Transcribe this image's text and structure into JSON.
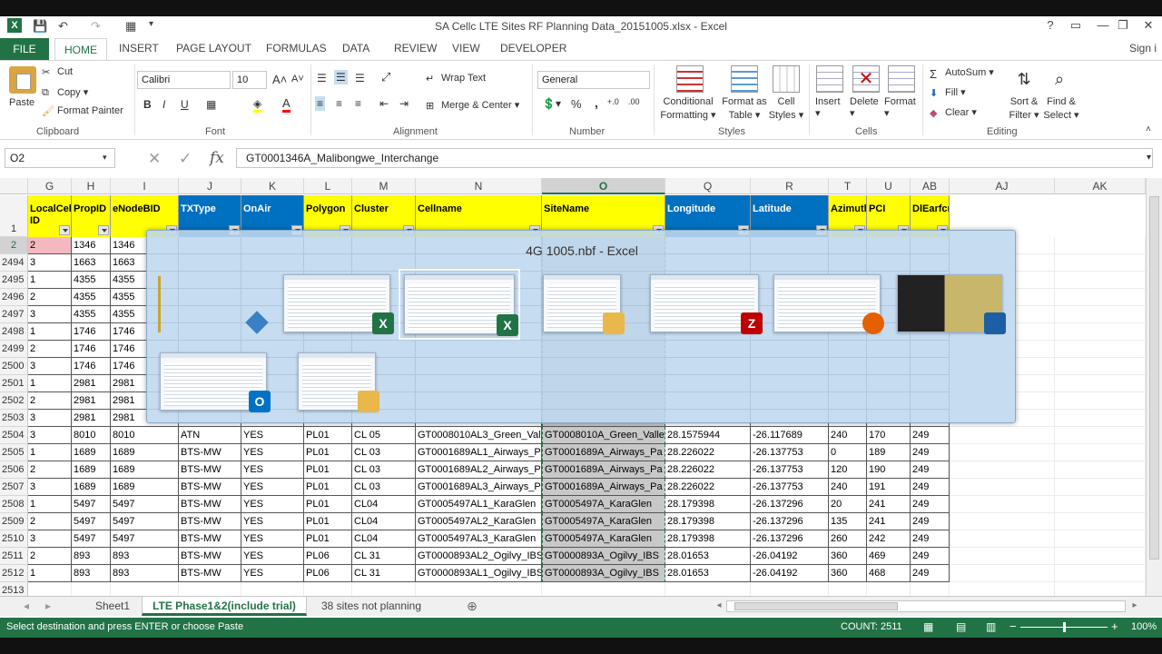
{
  "window": {
    "title": "SA Cellc  LTE  Sites RF Planning Data_20151005.xlsx - Excel",
    "controls": [
      "?",
      "▭",
      "—",
      "❐",
      "✕"
    ],
    "sign_in": "Sign i"
  },
  "ribbon_tabs": [
    "FILE",
    "HOME",
    "INSERT",
    "PAGE LAYOUT",
    "FORMULAS",
    "DATA",
    "REVIEW",
    "VIEW",
    "DEVELOPER"
  ],
  "ribbon": {
    "clipboard": {
      "paste": "Paste",
      "cut": "Cut",
      "copy": "Copy",
      "format_painter": "Format Painter",
      "label": "Clipboard"
    },
    "font": {
      "name": "Calibri",
      "size": "10",
      "bold": "B",
      "italic": "I",
      "underline": "U",
      "label": "Font"
    },
    "alignment": {
      "wrap_text": "Wrap Text",
      "merge_center": "Merge & Center",
      "label": "Alignment"
    },
    "number": {
      "format": "General",
      "percent": "%",
      "comma": ",",
      "label": "Number"
    },
    "styles": {
      "conditional": "Conditional",
      "conditional2": "Formatting",
      "format_as": "Format as",
      "format_as2": "Table",
      "cell": "Cell",
      "cell2": "Styles",
      "label": "Styles"
    },
    "cells": {
      "insert": "Insert",
      "delete": "Delete",
      "format": "Format",
      "label": "Cells"
    },
    "editing": {
      "autosum": "AutoSum",
      "fill": "Fill",
      "clear": "Clear",
      "sort": "Sort &",
      "sort2": "Filter",
      "find": "Find &",
      "find2": "Select",
      "label": "Editing"
    }
  },
  "formula_bar": {
    "name_box": "O2",
    "formula": "GT0001346A_Malibongwe_Interchange",
    "fx": "fx"
  },
  "columns": [
    {
      "letter": "G",
      "header": "LocalCell ID",
      "bg": "#ffff00"
    },
    {
      "letter": "H",
      "header": "PropID",
      "bg": "#ffff00"
    },
    {
      "letter": "I",
      "header": "eNodeBID",
      "bg": "#ffff00"
    },
    {
      "letter": "J",
      "header": "TXType",
      "bg": "#0070c0"
    },
    {
      "letter": "K",
      "header": "OnAir",
      "bg": "#0070c0"
    },
    {
      "letter": "L",
      "header": "Polygon",
      "bg": "#ffff00"
    },
    {
      "letter": "M",
      "header": "Cluster",
      "bg": "#ffff00"
    },
    {
      "letter": "N",
      "header": "Cellname",
      "bg": "#ffff00"
    },
    {
      "letter": "O",
      "header": "SiteName",
      "bg": "#ffff00"
    },
    {
      "letter": "Q",
      "header": "Longitude",
      "bg": "#0070c0"
    },
    {
      "letter": "R",
      "header": "Latitude",
      "bg": "#0070c0"
    },
    {
      "letter": "T",
      "header": "Azimuth",
      "bg": "#ffff00"
    },
    {
      "letter": "U",
      "header": "PCI",
      "bg": "#ffff00"
    },
    {
      "letter": "AB",
      "header": "DlEarfcn",
      "bg": "#ffff00"
    },
    {
      "letter": "AJ",
      "header": "",
      "bg": ""
    },
    {
      "letter": "AK",
      "header": "",
      "bg": ""
    }
  ],
  "rows": [
    {
      "num": "2",
      "cells": [
        "2",
        "1346",
        "1346",
        "",
        "",
        "",
        "",
        "",
        "",
        "",
        "",
        "",
        "",
        ""
      ]
    },
    {
      "num": "2494",
      "cells": [
        "3",
        "1663",
        "1663",
        "",
        "",
        "",
        "",
        "",
        "",
        "",
        "",
        "",
        "",
        ""
      ]
    },
    {
      "num": "2495",
      "cells": [
        "1",
        "4355",
        "4355",
        "",
        "",
        "",
        "",
        "",
        "",
        "",
        "",
        "",
        "",
        ""
      ]
    },
    {
      "num": "2496",
      "cells": [
        "2",
        "4355",
        "4355",
        "",
        "",
        "",
        "",
        "",
        "",
        "",
        "",
        "",
        "",
        ""
      ]
    },
    {
      "num": "2497",
      "cells": [
        "3",
        "4355",
        "4355",
        "",
        "",
        "",
        "",
        "",
        "",
        "",
        "",
        "",
        "",
        ""
      ]
    },
    {
      "num": "2498",
      "cells": [
        "1",
        "1746",
        "1746",
        "",
        "",
        "",
        "",
        "",
        "",
        "",
        "",
        "",
        "",
        ""
      ]
    },
    {
      "num": "2499",
      "cells": [
        "2",
        "1746",
        "1746",
        "",
        "",
        "",
        "",
        "",
        "",
        "",
        "",
        "",
        "",
        ""
      ]
    },
    {
      "num": "2500",
      "cells": [
        "3",
        "1746",
        "1746",
        "",
        "",
        "",
        "",
        "",
        "",
        "",
        "",
        "",
        "",
        ""
      ]
    },
    {
      "num": "2501",
      "cells": [
        "1",
        "2981",
        "2981",
        "",
        "",
        "",
        "",
        "",
        "",
        "",
        "",
        "",
        "",
        ""
      ]
    },
    {
      "num": "2502",
      "cells": [
        "2",
        "2981",
        "2981",
        "",
        "",
        "",
        "",
        "",
        "",
        "",
        "",
        "",
        "",
        ""
      ]
    },
    {
      "num": "2503",
      "cells": [
        "3",
        "2981",
        "2981",
        "",
        "",
        "",
        "",
        "",
        "",
        "",
        "",
        "",
        "",
        ""
      ]
    },
    {
      "num": "2504",
      "cells": [
        "3",
        "8010",
        "8010",
        "ATN",
        "YES",
        "PL01",
        "CL 05",
        "GT0008010AL3_Green_Vall",
        "GT0008010A_Green_Valle",
        "28.1575944",
        "-26.117689",
        "240",
        "170",
        "249"
      ]
    },
    {
      "num": "2505",
      "cells": [
        "1",
        "1689",
        "1689",
        "BTS-MW",
        "YES",
        "PL01",
        "CL 03",
        "GT0001689AL1_Airways_P",
        "GT0001689A_Airways_Pa",
        "28.226022",
        "-26.137753",
        "0",
        "189",
        "249"
      ]
    },
    {
      "num": "2506",
      "cells": [
        "2",
        "1689",
        "1689",
        "BTS-MW",
        "YES",
        "PL01",
        "CL 03",
        "GT0001689AL2_Airways_P",
        "GT0001689A_Airways_Pa",
        "28.226022",
        "-26.137753",
        "120",
        "190",
        "249"
      ]
    },
    {
      "num": "2507",
      "cells": [
        "3",
        "1689",
        "1689",
        "BTS-MW",
        "YES",
        "PL01",
        "CL 03",
        "GT0001689AL3_Airways_P",
        "GT0001689A_Airways_Pa",
        "28.226022",
        "-26.137753",
        "240",
        "191",
        "249"
      ]
    },
    {
      "num": "2508",
      "cells": [
        "1",
        "5497",
        "5497",
        "BTS-MW",
        "YES",
        "PL01",
        "CL04",
        "GT0005497AL1_KaraGlen",
        "GT0005497A_KaraGlen",
        "28.179398",
        "-26.137296",
        "20",
        "241",
        "249"
      ]
    },
    {
      "num": "2509",
      "cells": [
        "2",
        "5497",
        "5497",
        "BTS-MW",
        "YES",
        "PL01",
        "CL04",
        "GT0005497AL2_KaraGlen",
        "GT0005497A_KaraGlen",
        "28.179398",
        "-26.137296",
        "135",
        "241",
        "249"
      ]
    },
    {
      "num": "2510",
      "cells": [
        "3",
        "5497",
        "5497",
        "BTS-MW",
        "YES",
        "PL01",
        "CL04",
        "GT0005497AL3_KaraGlen",
        "GT0005497A_KaraGlen",
        "28.179398",
        "-26.137296",
        "260",
        "242",
        "249"
      ]
    },
    {
      "num": "2511",
      "cells": [
        "2",
        "893",
        "893",
        "BTS-MW",
        "YES",
        "PL06",
        "CL 31",
        "GT0000893AL2_Ogilvy_IBS",
        "GT0000893A_Ogilvy_IBS",
        "28.01653",
        "-26.04192",
        "360",
        "469",
        "249"
      ]
    },
    {
      "num": "2512",
      "cells": [
        "1",
        "893",
        "893",
        "BTS-MW",
        "YES",
        "PL06",
        "CL 31",
        "GT0000893AL1_Ogilvy_IBS",
        "GT0000893A_Ogilvy_IBS",
        "28.01653",
        "-26.04192",
        "360",
        "468",
        "249"
      ]
    },
    {
      "num": "2513",
      "cells": [
        "",
        "",
        "",
        "",
        "",
        "",
        "",
        "",
        "",
        "",
        "",
        "",
        "",
        ""
      ]
    }
  ],
  "switcher": {
    "title": "4G 1005.nbf - Excel",
    "items": [
      {
        "app": "Excel",
        "badge": "X",
        "color": "#217346"
      },
      {
        "app": "Excel",
        "badge": "X",
        "color": "#217346"
      },
      {
        "app": "File Explorer",
        "badge": "",
        "color": "#e8b84a"
      },
      {
        "app": "FileZilla",
        "badge": "Z",
        "color": "#bf0000"
      },
      {
        "app": "Firefox",
        "badge": "",
        "color": "#e66000"
      },
      {
        "app": "Desktop",
        "badge": "",
        "color": "#1d5fa6"
      },
      {
        "app": "Outlook",
        "badge": "O",
        "color": "#0072c6"
      },
      {
        "app": "File Explorer",
        "badge": "",
        "color": "#e8b84a"
      }
    ]
  },
  "sheets": [
    "Sheet1",
    "LTE Phase1&2(include trial)",
    "38 sites not planning"
  ],
  "active_sheet": "LTE Phase1&2(include trial)",
  "status": {
    "message": "Select destination and press ENTER or choose Paste",
    "count": "COUNT: 2511",
    "zoom": "100%"
  }
}
